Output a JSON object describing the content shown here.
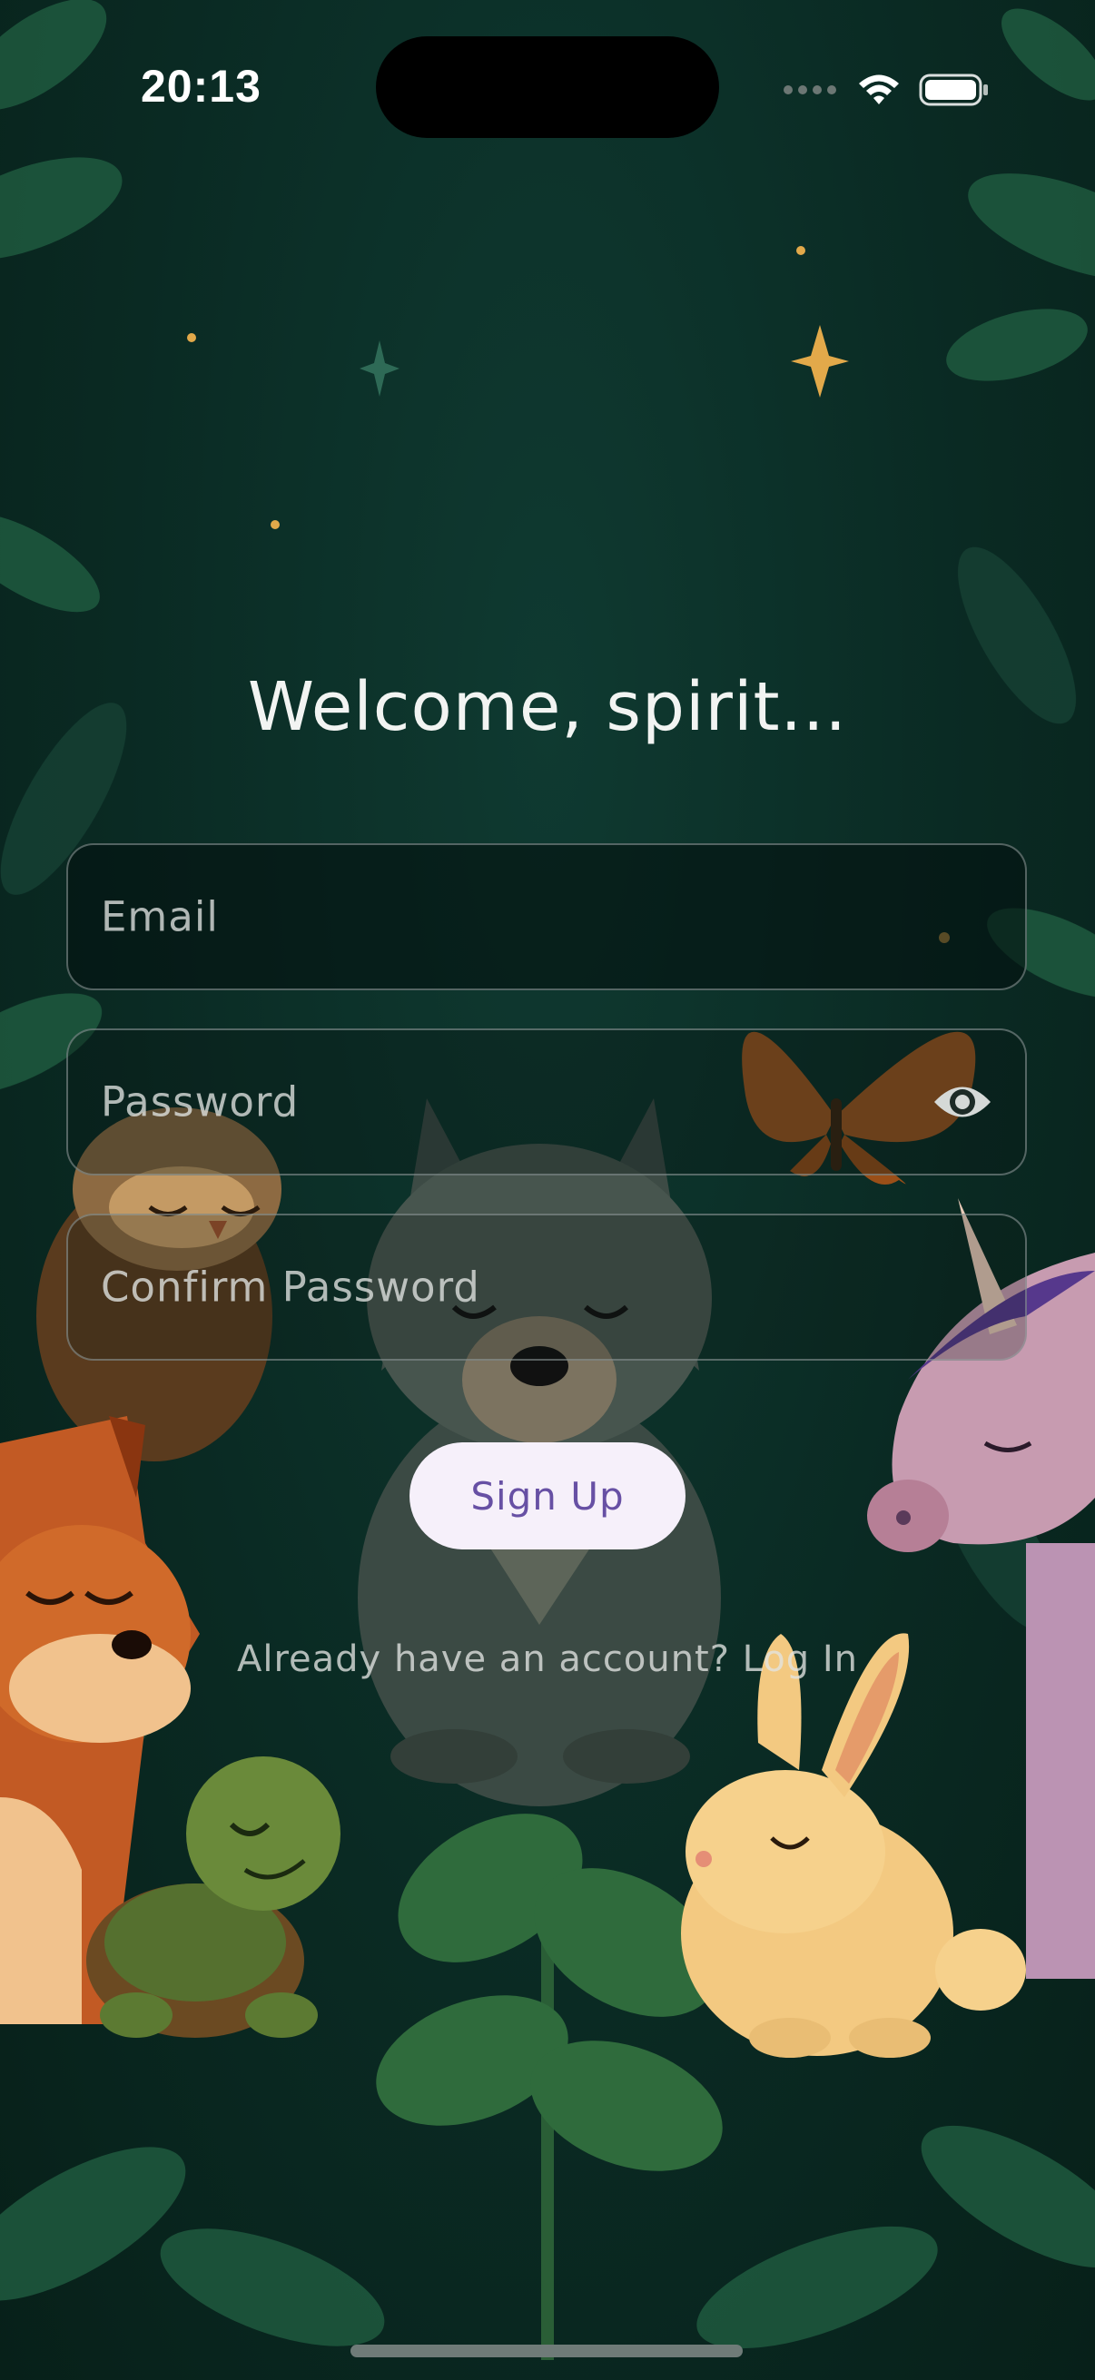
{
  "status_bar": {
    "time": "20:13",
    "icons": [
      "cellular-dots-icon",
      "wifi-icon",
      "battery-icon"
    ]
  },
  "form": {
    "title": "Welcome, spirit...",
    "email_placeholder": "Email",
    "password_placeholder": "Password",
    "confirm_password_placeholder": "Confirm Password",
    "signup_label": "Sign Up",
    "login_prompt": "Already have an account? Log In"
  },
  "colors": {
    "background": "#0b2b24",
    "button_bg": "#f6f0fa",
    "button_text": "#6750a4",
    "field_border": "#8f9a98"
  },
  "illustration": {
    "characters": [
      "owl",
      "wolf",
      "butterfly",
      "unicorn",
      "fox",
      "turtle",
      "rabbit"
    ]
  }
}
